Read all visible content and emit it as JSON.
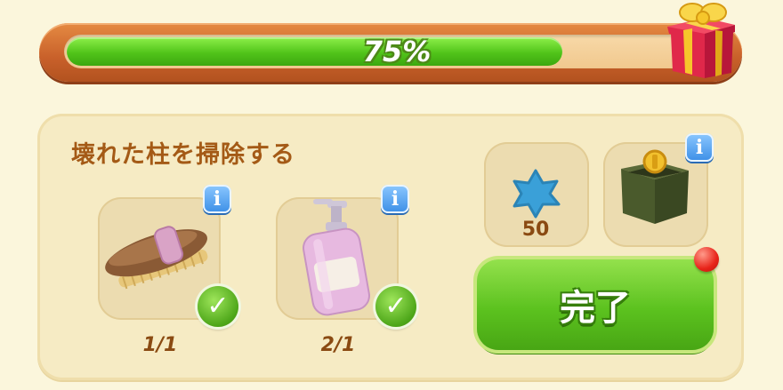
{
  "progress": {
    "label": "75%",
    "fraction": 0.75
  },
  "task": {
    "title": "壊れた柱を掃除する",
    "items": [
      {
        "name": "brush",
        "icon": "brush-icon",
        "count": "1/1",
        "done": true
      },
      {
        "name": "soap",
        "icon": "soap-bottle-icon",
        "count": "2/1",
        "done": true
      }
    ]
  },
  "rewards": {
    "star": {
      "icon": "blue-star-icon",
      "value": "50"
    },
    "chest": {
      "icon": "coin-chest-icon"
    }
  },
  "complete_button": {
    "label": "完了"
  },
  "colors": {
    "accent_green": "#5cc21f",
    "title_brown": "#a45a16",
    "info_blue": "#3b8ee6"
  }
}
